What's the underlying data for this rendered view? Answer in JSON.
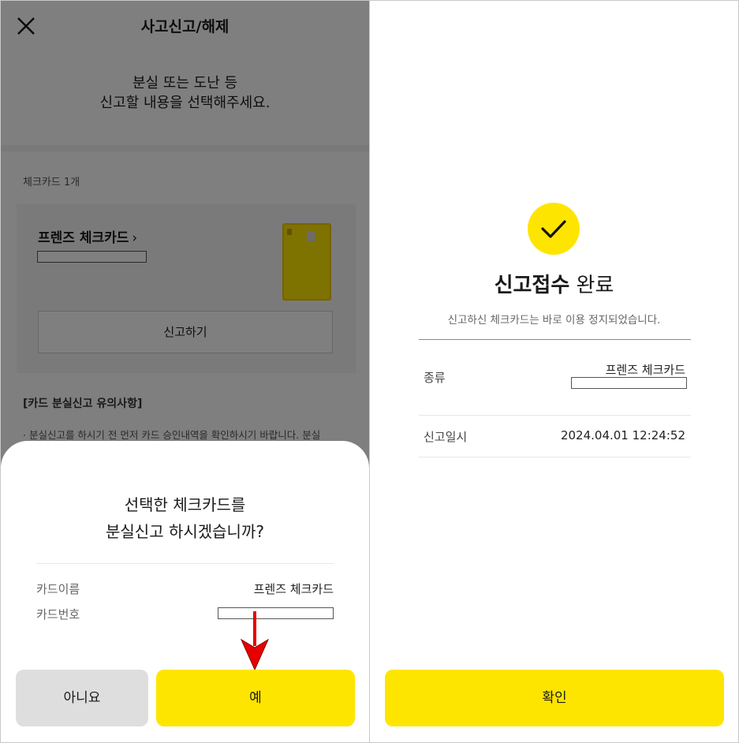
{
  "left": {
    "header": {
      "title": "사고신고/해제",
      "close_icon": "close-icon"
    },
    "intro": {
      "line1": "분실 또는 도난 등",
      "line2": "신고할 내용을 선택해주세요."
    },
    "cards": {
      "count_label": "체크카드 1개",
      "card_name": "프렌즈 체크카드",
      "chevron": "›",
      "report_button": "신고하기"
    },
    "notice": {
      "title": "[카드 분실신고 유의사항]",
      "text": "· 분실신고를 하시기 전 먼저 카드 승인내역을 확인하시기 바랍니다. 분실"
    },
    "sheet": {
      "question_line1": "선택한 체크카드를",
      "question_line2": "분실신고 하시겠습니까?",
      "rows": [
        {
          "label": "카드이름",
          "value": "프렌즈 체크카드"
        },
        {
          "label": "카드번호",
          "value": ""
        }
      ],
      "no_button": "아니요",
      "yes_button": "예"
    }
  },
  "right": {
    "result": {
      "title_bold": "신고접수",
      "title_rest": " 완료",
      "subtitle": "신고하신 체크카드는 바로 이용 정지되었습니다."
    },
    "rows": [
      {
        "label": "종류",
        "value": "프렌즈 체크카드"
      },
      {
        "label": "신고일시",
        "value": "2024.04.01 12:24:52"
      }
    ],
    "confirm_button": "확인"
  },
  "colors": {
    "accent": "#fee500",
    "arrow": "#e60000",
    "overlay": "rgba(0,0,0,0.5)"
  }
}
